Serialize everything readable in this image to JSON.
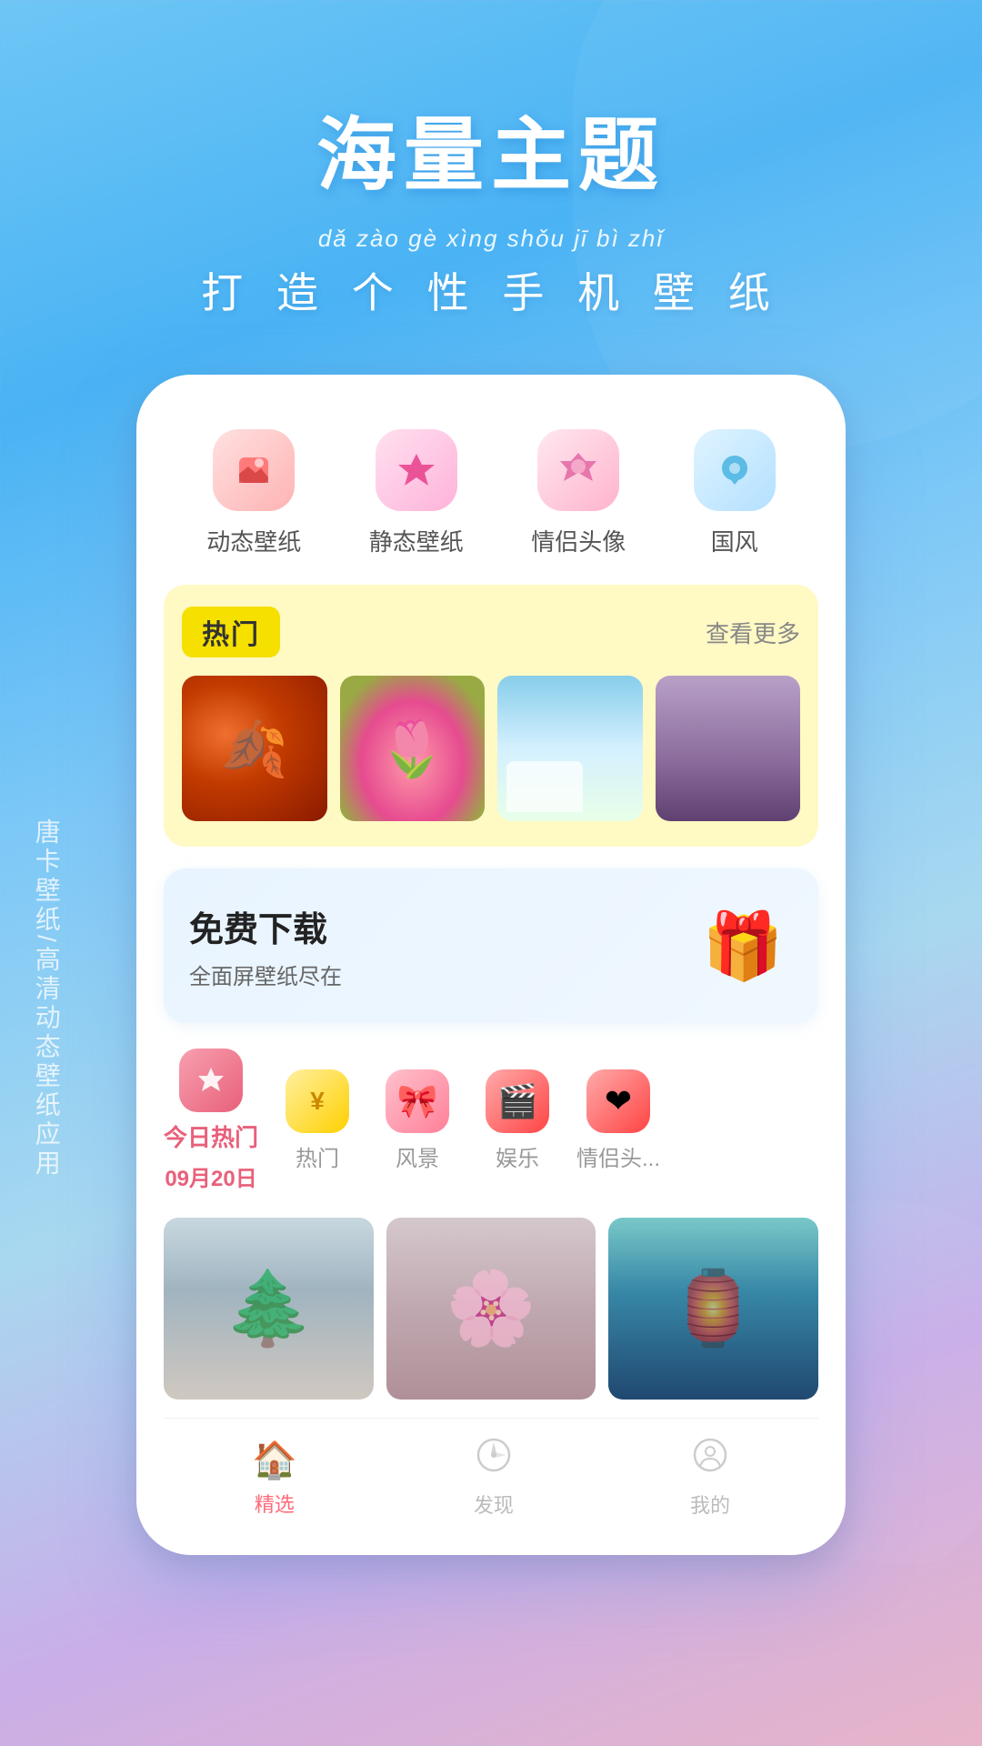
{
  "header": {
    "main_title": "海量主题",
    "pinyin": "dǎ  zào  gè  xìng  shǒu  jī  bì  zhǐ",
    "subtitle": "打 造 个 性 手 机 壁 纸"
  },
  "side_text": "唐卡壁纸/高清动态壁纸应用",
  "categories": [
    {
      "icon": "🎞",
      "label": "动态壁纸",
      "bg": "cat-icon-1"
    },
    {
      "icon": "⭐",
      "label": "静态壁纸",
      "bg": "cat-icon-2"
    },
    {
      "icon": "👑",
      "label": "情侣头像",
      "bg": "cat-icon-3"
    },
    {
      "icon": "💎",
      "label": "国风",
      "bg": "cat-icon-4"
    }
  ],
  "hot_section": {
    "tag": "热门",
    "see_more": "查看更多"
  },
  "free_banner": {
    "title": "免费下载",
    "subtitle": "全面屏壁纸尽在"
  },
  "date_tabs": [
    {
      "icon": "👑",
      "main_label": "今日热门",
      "sub_label": "09月20日",
      "is_active": true,
      "icon_class": "active"
    },
    {
      "icon": "¥",
      "label": "热门",
      "icon_class": "yellow"
    },
    {
      "icon": "🎀",
      "label": "风景",
      "icon_class": "pink"
    },
    {
      "icon": "🎬",
      "label": "娱乐",
      "icon_class": "red"
    },
    {
      "icon": "❤",
      "label": "情侣头...",
      "icon_class": "red2"
    }
  ],
  "nav": {
    "items": [
      {
        "icon": "🏠",
        "label": "精选",
        "active": true
      },
      {
        "icon": "🧭",
        "label": "发现",
        "active": false
      },
      {
        "icon": "😊",
        "label": "我的",
        "active": false
      }
    ]
  }
}
